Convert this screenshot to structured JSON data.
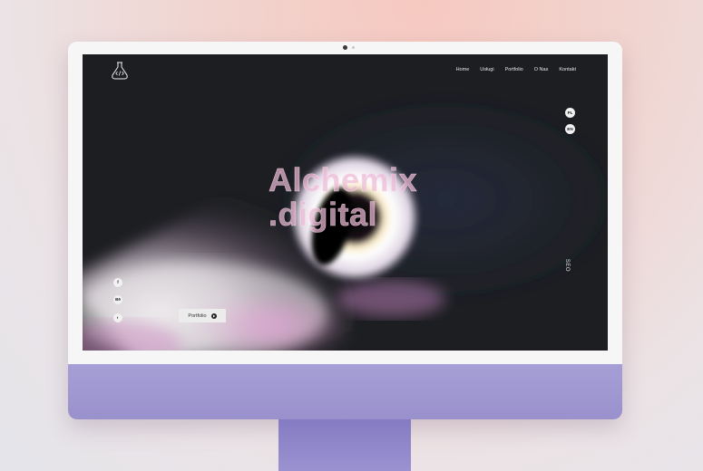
{
  "site": {
    "logo_icon": "alchemy-flask-code-icon",
    "nav": [
      {
        "label": "Home"
      },
      {
        "label": "Usługi"
      },
      {
        "label": "Portfolio"
      },
      {
        "label": "O Nas"
      },
      {
        "label": "Kontakt"
      }
    ],
    "lang": [
      {
        "label": "PL"
      },
      {
        "label": "EN"
      }
    ],
    "hero": {
      "line1": "Alchemix",
      "line2": ".digital"
    },
    "social": [
      {
        "icon": "facebook-icon",
        "glyph": "f"
      },
      {
        "icon": "behance-icon",
        "glyph": "Bē"
      },
      {
        "icon": "github-icon",
        "glyph": "◐"
      }
    ],
    "cta": {
      "label": "Portfolio",
      "icon": "arrow-circle-icon"
    },
    "vertical_text": "SEO"
  },
  "colors": {
    "screen_bg": "#1c1e21",
    "chin": "#a69fd6",
    "hero_text": "#ecbad6"
  }
}
